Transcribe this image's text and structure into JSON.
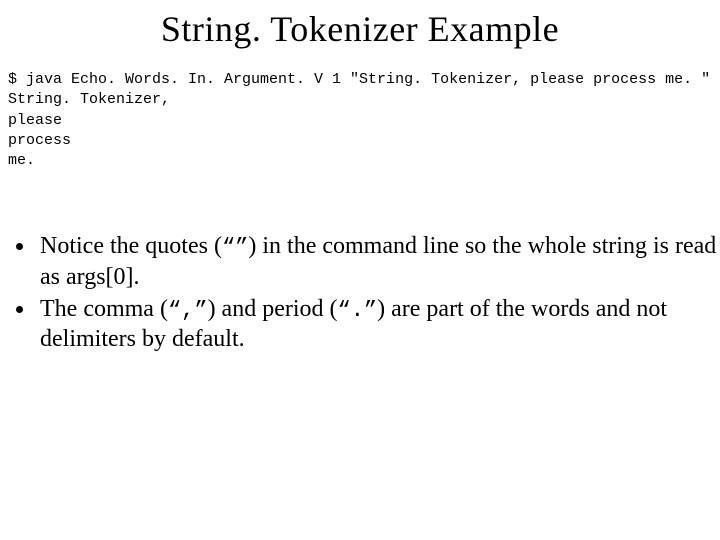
{
  "title": "String. Tokenizer Example",
  "code": {
    "line1": "$ java Echo. Words. In. Argument. V 1 \"String. Tokenizer, please process me. \"",
    "line2": "String. Tokenizer,",
    "line3": "please",
    "line4": "process",
    "line5": "me."
  },
  "bullets": {
    "b1_pre": "Notice the quotes (",
    "b1_sym": "“”",
    "b1_post": ") in the command line so the whole string is read as args[0].",
    "b2_pre": "The comma (",
    "b2_sym1": "“,”",
    "b2_mid": ")  and period (",
    "b2_sym2": "“.”",
    "b2_post": ") are part of the words and not delimiters by default."
  }
}
